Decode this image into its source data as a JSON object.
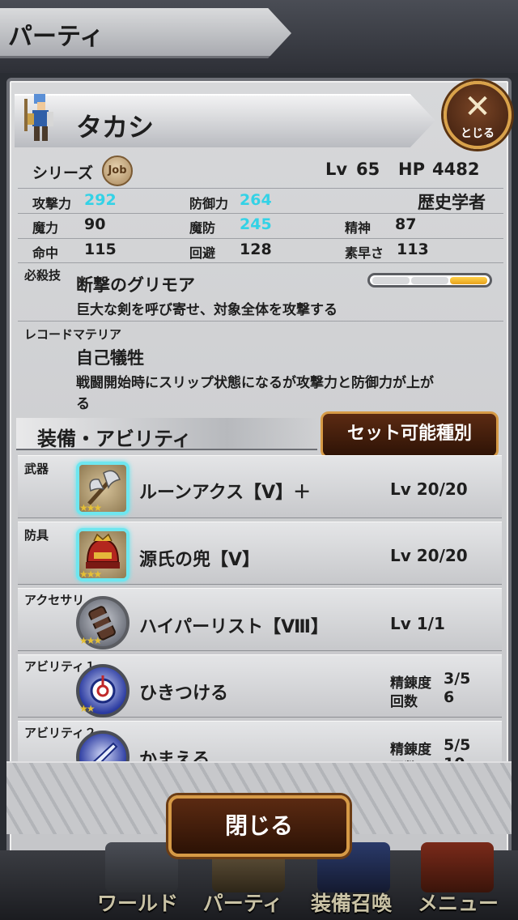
{
  "header": {
    "title": "パーティ"
  },
  "character": {
    "name": "タカシ",
    "close_label": "とじる",
    "close_glyph": "✕",
    "series_label": "シリーズ",
    "series_icon_text": "Job",
    "lv_label": "Lv",
    "lv": "65",
    "hp_label": "HP",
    "hp": "4482",
    "job": "歴史学者",
    "stats": {
      "atk_label": "攻撃力",
      "atk": "292",
      "def_label": "防御力",
      "def": "264",
      "mag_label": "魔力",
      "mag": "90",
      "res_label": "魔防",
      "res": "245",
      "mnd_label": "精神",
      "mnd": "87",
      "acc_label": "命中",
      "acc": "115",
      "eva_label": "回避",
      "eva": "128",
      "spd_label": "素早さ",
      "spd": "113"
    },
    "soul_break": {
      "label": "必殺技",
      "name": "断撃のグリモア",
      "desc": "巨大な剣を呼び寄せ、対象全体を攻撃する",
      "gauge_segments_filled": 1,
      "gauge_segments_total": 3
    },
    "record_materia": {
      "label": "レコードマテリア",
      "name": "自己犠牲",
      "desc_line1": "戦闘開始時にスリップ状態になるが攻撃力と防御力が上が",
      "desc_line2": "る"
    }
  },
  "equipment": {
    "section_title": "装備・アビリティ",
    "set_button": "セット可能種別",
    "slots": [
      {
        "label": "武器",
        "name": "ルーンアクス【V】＋",
        "lv": "Lv  20/20",
        "stars": "★★★"
      },
      {
        "label": "防具",
        "name": "源氏の兜【V】",
        "lv": "Lv  20/20",
        "stars": "★★★"
      },
      {
        "label": "アクセサリ",
        "name": "ハイパーリスト【Ⅷ】",
        "lv": "Lv  1/1",
        "stars": "★★★"
      },
      {
        "label": "アビリティ１",
        "name": "ひきつける",
        "refine_label": "精錬度",
        "refine": "3/5",
        "uses_label": "回数",
        "uses": "6",
        "stars": "★★"
      },
      {
        "label": "アビリティ２",
        "name": "かまえる",
        "refine_label": "精錬度",
        "refine": "5/5",
        "uses_label": "回数",
        "uses": "10",
        "stars": "★★"
      }
    ]
  },
  "close_button": "閉じる",
  "nav": {
    "items": [
      "ワールド",
      "パーティ",
      "装備召喚",
      "メニュー"
    ]
  },
  "colors": {
    "accent_cyan": "#33d2e6",
    "button_brown": "#3a1b09",
    "button_gold_border": "#d69a46"
  }
}
